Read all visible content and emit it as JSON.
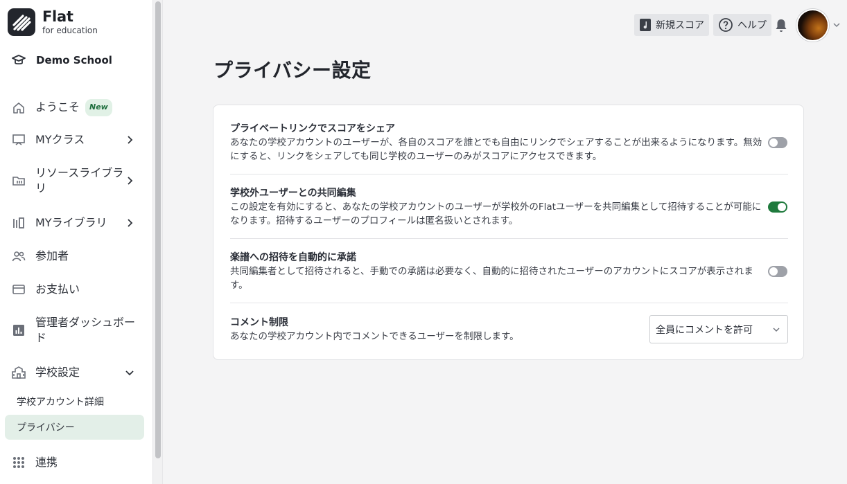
{
  "brand": {
    "name": "Flat",
    "sub": "for education"
  },
  "school": {
    "name": "Demo School"
  },
  "nav": {
    "welcome": {
      "label": "ようこそ",
      "badge": "New"
    },
    "my_class": {
      "label": "MYクラス"
    },
    "resource_library": {
      "label": "リソースライブラリ"
    },
    "my_library": {
      "label": "MYライブラリ"
    },
    "participants": {
      "label": "参加者"
    },
    "payment": {
      "label": "お支払い"
    },
    "admin_dashboard": {
      "label": "管理者ダッシュボード"
    },
    "school_settings": {
      "label": "学校設定"
    },
    "school_account_details": {
      "label": "学校アカウント詳細"
    },
    "privacy": {
      "label": "プライバシー"
    },
    "integrations": {
      "label": "連携"
    }
  },
  "topbar": {
    "new_score": "新規スコア",
    "help": "ヘルプ"
  },
  "page": {
    "title": "プライバシー設定"
  },
  "settings": [
    {
      "title": "プライベートリンクでスコアをシェア",
      "desc": "あなたの学校アカウントのユーザーが、各自のスコアを誰とでも自由にリンクでシェアすることが出来るようになります。無効にすると、リンクをシェアしても同じ学校のユーザーのみがスコアにアクセスできます。",
      "enabled": false
    },
    {
      "title": "学校外ユーザーとの共同編集",
      "desc": "この設定を有効にすると、あなたの学校アカウントのユーザーが学校外のFlatユーザーを共同編集として招待することが可能になります。招待するユーザーのプロフィールは匿名扱いとされます。",
      "enabled": true
    },
    {
      "title": "楽譜への招待を自動的に承諾",
      "desc": "共同編集者として招待されると、手動での承諾は必要なく、自動的に招待されたユーザーのアカウントにスコアが表示されます。",
      "enabled": false
    },
    {
      "title": "コメント制限",
      "desc": "あなたの学校アカウント内でコメントできるユーザーを制限します。",
      "select_value": "全員にコメントを許可"
    }
  ],
  "colors": {
    "accent": "#1f7a3d",
    "active_bg": "#e3efe8"
  }
}
